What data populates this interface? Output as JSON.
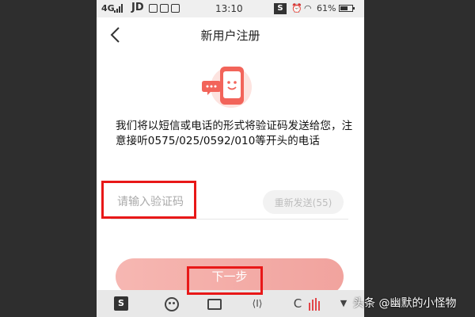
{
  "status_bar": {
    "network": "4G",
    "carrier_app": "JD",
    "time": "13:10",
    "sogou": "S",
    "battery": "61%",
    "battery_level": 0.61
  },
  "header": {
    "back_icon": "chevron-left-icon",
    "title": "新用户注册"
  },
  "illustration": {
    "icon": "phone-chat-illustration",
    "accent": "#f2645a"
  },
  "message": {
    "text": "我们将以短信或电话的形式将验证码发送给您，注意接听0575/025/0592/010等开头的电话"
  },
  "verification": {
    "placeholder": "请输入验证码",
    "value": "",
    "resend_label": "重新发送(55)"
  },
  "next_button": {
    "label": "下一步"
  },
  "keyboard_toolbar": {
    "items": [
      "sogou-icon",
      "emoji-icon",
      "keyboard-icon",
      "cursor-icon",
      "clipboard-icon",
      "bars-icon",
      "collapse-icon"
    ],
    "sogou_label": "S",
    "cursor_label": "⟨I⟩",
    "clip_label": "C",
    "collapse_label": "▼"
  },
  "watermark": {
    "text": "头条 @幽默的小怪物"
  },
  "colors": {
    "annotation": "#e81818",
    "next_button": "#f3aaa5",
    "resend_bg": "#f2f2f2"
  }
}
